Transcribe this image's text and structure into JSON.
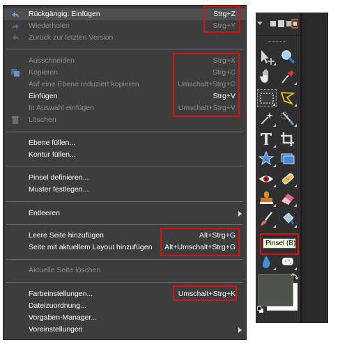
{
  "menu": {
    "items": [
      {
        "label": "Rückgängig: Einfügen",
        "shortcut": "Strg+Z",
        "disabled": false,
        "icon": "undo-icon"
      },
      {
        "label": "Wiederholen",
        "shortcut": "Strg+Y",
        "disabled": true,
        "icon": "redo-icon"
      },
      {
        "label": "Zurück zur letzten Version",
        "shortcut": "",
        "disabled": true,
        "icon": "revert-icon"
      },
      {
        "label": "Ausschneiden",
        "shortcut": "Strg+X",
        "disabled": true
      },
      {
        "label": "Kopieren",
        "shortcut": "Strg+C",
        "disabled": true,
        "icon": "copy-icon"
      },
      {
        "label": "Auf eine Ebene reduziert kopieren",
        "shortcut": "Umschalt+Strg+C",
        "disabled": true
      },
      {
        "label": "Einfügen",
        "shortcut": "Strg+V",
        "disabled": false
      },
      {
        "label": "In Auswahl einfügen",
        "shortcut": "Umschalt+Strg+V",
        "disabled": true
      },
      {
        "label": "Löschen",
        "shortcut": "",
        "disabled": true,
        "icon": "trash-icon"
      },
      {
        "label": "Ebene füllen...",
        "shortcut": "",
        "disabled": false
      },
      {
        "label": "Kontur füllen...",
        "shortcut": "",
        "disabled": false
      },
      {
        "label": "Pinsel definieren...",
        "shortcut": "",
        "disabled": false
      },
      {
        "label": "Muster festlegen...",
        "shortcut": "",
        "disabled": false
      },
      {
        "label": "Entleeren",
        "shortcut": "",
        "disabled": false,
        "submenu": true
      },
      {
        "label": "Leere Seite hinzufügen",
        "shortcut": "Alt+Strg+G",
        "disabled": false
      },
      {
        "label": "Seite mit aktuellem Layout hinzufügen",
        "shortcut": "Alt+Umschalt+Strg+G",
        "disabled": false
      },
      {
        "label": "Aktuelle Seite löschen",
        "shortcut": "",
        "disabled": true
      },
      {
        "label": "Farbeinstellungen...",
        "shortcut": "Umschalt+Strg+K",
        "disabled": false
      },
      {
        "label": "Dateizuordnung...",
        "shortcut": "",
        "disabled": false
      },
      {
        "label": "Vorgaben-Manager...",
        "shortcut": "",
        "disabled": false
      },
      {
        "label": "Voreinstellungen",
        "shortcut": "",
        "disabled": false,
        "submenu": true
      }
    ]
  },
  "toolbox": {
    "tooltip": "Pinsel (B)",
    "tools": [
      "move-tool-icon",
      "zoom-tool-icon",
      "hand-tool-icon",
      "eyedropper-tool-icon",
      "rectangular-marquee-tool-icon",
      "lasso-tool-icon",
      "magic-wand-tool-icon",
      "selection-brush-tool-icon",
      "type-tool-icon",
      "crop-tool-icon",
      "cookie-cutter-tool-icon",
      "straighten-tool-icon",
      "red-eye-tool-icon",
      "healing-brush-tool-icon",
      "clone-stamp-tool-icon",
      "eraser-tool-icon",
      "brush-tool-icon",
      "paint-bucket-tool-icon",
      "blur-tool-icon",
      "sponge-tool-icon"
    ]
  },
  "colors": {
    "menu_bg": "#3d3d3d",
    "highlight": "#e01010",
    "foreground_color": "#4d524a",
    "background_color": "#ffffff"
  }
}
